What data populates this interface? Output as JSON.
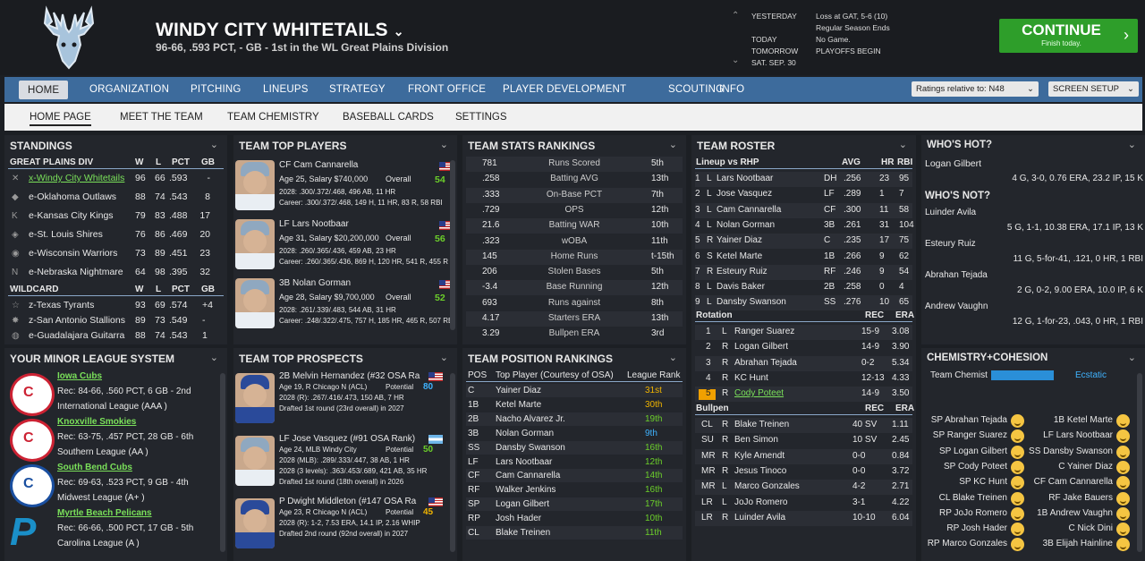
{
  "header": {
    "team": "WINDY CITY WHITETAILS",
    "record": "96-66, .593 PCT, - GB - 1st in the WL Great Plains Division",
    "yesterday_label": "YESTERDAY",
    "yesterday": "Loss at GAT, 5-6 (10)",
    "yesterday2": "Regular Season Ends",
    "today_label": "TODAY",
    "today": "No Game.",
    "tomorrow_label": "TOMORROW",
    "tomorrow": "PLAYOFFS BEGIN",
    "date": "SAT. SEP. 30",
    "continue": "CONTINUE",
    "continue_sub": "Finish today."
  },
  "nav": [
    "HOME",
    "ORGANIZATION",
    "PITCHING",
    "LINEUPS",
    "STRATEGY",
    "FRONT OFFICE",
    "PLAYER DEVELOPMENT",
    "SCOUTING",
    "INFO"
  ],
  "ratings_select": "Ratings relative to: N48",
  "screen_setup": "SCREEN SETUP",
  "subnav": [
    "HOME PAGE",
    "MEET THE TEAM",
    "TEAM CHEMISTRY",
    "BASEBALL CARDS",
    "SETTINGS"
  ],
  "standings": {
    "title": "STANDINGS",
    "div": "GREAT PLAINS DIV",
    "cols": [
      "W",
      "L",
      "PCT",
      "GB"
    ],
    "rows": [
      [
        "x-Windy City Whitetails",
        "96",
        "66",
        ".593",
        "-"
      ],
      [
        "e-Oklahoma Outlaws",
        "88",
        "74",
        ".543",
        "8"
      ],
      [
        "e-Kansas City Kings",
        "79",
        "83",
        ".488",
        "17"
      ],
      [
        "e-St. Louis Shires",
        "76",
        "86",
        ".469",
        "20"
      ],
      [
        "e-Wisconsin Warriors",
        "73",
        "89",
        ".451",
        "23"
      ],
      [
        "e-Nebraska Nightmare",
        "64",
        "98",
        ".395",
        "32"
      ]
    ],
    "wc": "WILDCARD",
    "wcrows": [
      [
        "z-Texas Tyrants",
        "93",
        "69",
        ".574",
        "+4"
      ],
      [
        "z-San Antonio Stallions",
        "89",
        "73",
        ".549",
        "-"
      ],
      [
        "e-Guadalajara Guitarra",
        "88",
        "74",
        ".543",
        "1"
      ]
    ]
  },
  "top_players": {
    "title": "TEAM TOP PLAYERS",
    "players": [
      {
        "name": "CF Cam Cannarella",
        "info": "Age 25, Salary $740,000",
        "ov_label": "Overall",
        "ov": "54",
        "l1": "2028: .300/.372/.468, 496 AB, 11 HR",
        "l2": "Career: .300/.372/.468, 149 H, 11 HR, 83 R, 58 RBI"
      },
      {
        "name": "LF Lars Nootbaar",
        "info": "Age 31, Salary $20,200,000",
        "ov_label": "Overall",
        "ov": "56",
        "l1": "2028: .260/.365/.436, 459 AB, 23 HR",
        "l2": "Career: .260/.365/.436, 869 H, 120 HR, 541 R, 455 R"
      },
      {
        "name": "3B Nolan Gorman",
        "info": "Age 28, Salary $9,700,000",
        "ov_label": "Overall",
        "ov": "52",
        "l1": "2028: .261/.339/.483, 544 AB, 31 HR",
        "l2": "Career: .248/.322/.475, 757 H, 185 HR, 465 R, 507 RBI"
      }
    ]
  },
  "team_stats": {
    "title": "TEAM STATS RANKINGS",
    "rows": [
      [
        "781",
        "Runs Scored",
        "5th"
      ],
      [
        ".258",
        "Batting AVG",
        "13th"
      ],
      [
        ".333",
        "On-Base PCT",
        "7th"
      ],
      [
        ".729",
        "OPS",
        "12th"
      ],
      [
        "21.6",
        "Batting WAR",
        "10th"
      ],
      [
        ".323",
        "wOBA",
        "11th"
      ],
      [
        "145",
        "Home Runs",
        "t-15th"
      ],
      [
        "206",
        "Stolen Bases",
        "5th"
      ],
      [
        "-3.4",
        "Base Running",
        "12th"
      ],
      [
        "693",
        "Runs against",
        "8th"
      ],
      [
        "4.17",
        "Starters ERA",
        "13th"
      ],
      [
        "3.29",
        "Bullpen ERA",
        "3rd"
      ]
    ]
  },
  "roster": {
    "title": "TEAM ROSTER",
    "lineup_label": "Lineup vs RHP",
    "cols": [
      "AVG",
      "HR",
      "RBI"
    ],
    "lineup": [
      [
        "1",
        "L",
        "Lars Nootbaar",
        "DH",
        ".256",
        "23",
        "95"
      ],
      [
        "2",
        "L",
        "Jose Vasquez",
        "LF",
        ".289",
        "1",
        "7"
      ],
      [
        "3",
        "L",
        "Cam Cannarella",
        "CF",
        ".300",
        "11",
        "58"
      ],
      [
        "4",
        "L",
        "Nolan Gorman",
        "3B",
        ".261",
        "31",
        "104"
      ],
      [
        "5",
        "R",
        "Yainer Diaz",
        "C",
        ".235",
        "17",
        "75"
      ],
      [
        "6",
        "S",
        "Ketel Marte",
        "1B",
        ".266",
        "9",
        "62"
      ],
      [
        "7",
        "R",
        "Esteury Ruiz",
        "RF",
        ".246",
        "9",
        "54"
      ],
      [
        "8",
        "L",
        "Davis Baker",
        "2B",
        ".258",
        "0",
        "4"
      ],
      [
        "9",
        "L",
        "Dansby Swanson",
        "SS",
        ".276",
        "10",
        "65"
      ]
    ],
    "rot_label": "Rotation",
    "rcols": [
      "REC",
      "ERA"
    ],
    "rotation": [
      [
        "1",
        "L",
        "Ranger Suarez",
        "15-9",
        "3.08"
      ],
      [
        "2",
        "R",
        "Logan Gilbert",
        "14-9",
        "3.90"
      ],
      [
        "3",
        "R",
        "Abrahan Tejada",
        "0-2",
        "5.34"
      ],
      [
        "4",
        "R",
        "KC Hunt",
        "12-13",
        "4.33"
      ],
      [
        "5",
        "R",
        "Cody Poteet",
        "14-9",
        "3.50"
      ]
    ],
    "bp_label": "Bullpen",
    "bullpen": [
      [
        "CL",
        "R",
        "Blake Treinen",
        "40 SV",
        "1.11"
      ],
      [
        "SU",
        "R",
        "Ben Simon",
        "10 SV",
        "2.45"
      ],
      [
        "MR",
        "R",
        "Kyle Amendt",
        "0-0",
        "0.84"
      ],
      [
        "MR",
        "R",
        "Jesus Tinoco",
        "0-0",
        "3.72"
      ],
      [
        "MR",
        "L",
        "Marco Gonzales",
        "4-2",
        "2.71"
      ],
      [
        "LR",
        "L",
        "JoJo Romero",
        "3-1",
        "4.22"
      ],
      [
        "LR",
        "R",
        "Luinder Avila",
        "10-10",
        "6.04"
      ]
    ]
  },
  "hot": {
    "title": "WHO'S HOT?",
    "p1": "Logan Gilbert",
    "s1": "4 G, 3-0, 0.76 ERA, 23.2 IP, 15 K",
    "not_title": "WHO'S NOT?",
    "nots": [
      [
        "Luinder Avila",
        "5 G, 1-1, 10.38 ERA, 17.1 IP, 13 K"
      ],
      [
        "Esteury Ruiz",
        "11 G, 5-for-41, .121, 0 HR, 1 RBI"
      ],
      [
        "Abrahan Tejada",
        "2 G, 0-2, 9.00 ERA, 10.0 IP, 6 K"
      ],
      [
        "Andrew Vaughn",
        "12 G, 1-for-23, .043, 0 HR, 1 RBI"
      ]
    ]
  },
  "minors": {
    "title": "YOUR MINOR LEAGUE SYSTEM",
    "teams": [
      {
        "name": "Iowa Cubs",
        "l1": "Rec: 84-66, .560 PCT, 6 GB - 2nd",
        "l2": "International League (AAA )"
      },
      {
        "name": "Knoxville Smokies",
        "l1": "Rec: 63-75, .457 PCT, 28 GB - 6th",
        "l2": "Southern League (AA )"
      },
      {
        "name": "South Bend Cubs",
        "l1": "Rec: 69-63, .523 PCT, 9 GB - 4th",
        "l2": "Midwest League (A+ )"
      },
      {
        "name": "Myrtle Beach Pelicans",
        "l1": "Rec: 66-66, .500 PCT, 17 GB - 5th",
        "l2": "Carolina League (A )"
      }
    ]
  },
  "prospects": {
    "title": "TEAM TOP PROSPECTS",
    "list": [
      {
        "name": "2B Melvin Hernandez (#32 OSA Ra",
        "info": "Age 19, R Chicago N (ACL)",
        "pot_label": "Potential",
        "pot": "80",
        "l1": "2028 (R): .267/.416/.473, 150 AB, 7 HR",
        "l2": "Drafted 1st round (23rd overall) in 2027"
      },
      {
        "name": "LF Jose Vasquez (#91 OSA Rank)",
        "info": "Age 24, MLB Windy City",
        "pot_label": "Potential",
        "pot": "50",
        "l1": "2028 (MLB): .289/.333/.447, 38 AB, 1 HR",
        "l2": "2028 (3 levels): .363/.453/.689, 421 AB, 35 HR",
        "l3": "Drafted 1st round (18th overall) in 2026"
      },
      {
        "name": "P Dwight Middleton (#147 OSA Ra",
        "info": "Age 23, R Chicago N (ACL)",
        "pot_label": "Potential",
        "pot": "45",
        "l1": "2028 (R): 1-2, 7.53 ERA, 14.1 IP, 2.16 WHIP",
        "l2": "Drafted 2nd round (92nd overall) in 2027"
      }
    ]
  },
  "positions": {
    "title": "TEAM POSITION RANKINGS",
    "cols": [
      "POS",
      "Top Player (Courtesy of OSA)",
      "League Rank"
    ],
    "rows": [
      [
        "C",
        "Yainer Diaz",
        "31st"
      ],
      [
        "1B",
        "Ketel Marte",
        "30th"
      ],
      [
        "2B",
        "Nacho Alvarez Jr.",
        "19th"
      ],
      [
        "3B",
        "Nolan Gorman",
        "9th"
      ],
      [
        "SS",
        "Dansby Swanson",
        "16th"
      ],
      [
        "LF",
        "Lars Nootbaar",
        "12th"
      ],
      [
        "CF",
        "Cam Cannarella",
        "14th"
      ],
      [
        "RF",
        "Walker Jenkins",
        "16th"
      ],
      [
        "SP",
        "Logan Gilbert",
        "17th"
      ],
      [
        "RP",
        "Josh Hader",
        "10th"
      ],
      [
        "CL",
        "Blake Treinen",
        "11th"
      ]
    ]
  },
  "chem": {
    "title": "CHEMISTRY+COHESION",
    "label": "Team Chemist",
    "value": "Ecstatic",
    "left": [
      "SP Abrahan Tejada",
      "SP Ranger Suarez",
      "SP Logan Gilbert",
      "SP Cody Poteet",
      "SP KC Hunt",
      "CL Blake Treinen",
      "RP JoJo Romero",
      "RP Josh Hader",
      "RP Marco Gonzales"
    ],
    "right": [
      "1B Ketel Marte",
      "LF Lars Nootbaar",
      "SS Dansby Swanson",
      "C Yainer Diaz",
      "CF Cam Cannarella",
      "RF Jake Bauers",
      "1B Andrew Vaughn",
      "C Nick Dini",
      "3B Elijah Hainline"
    ]
  }
}
